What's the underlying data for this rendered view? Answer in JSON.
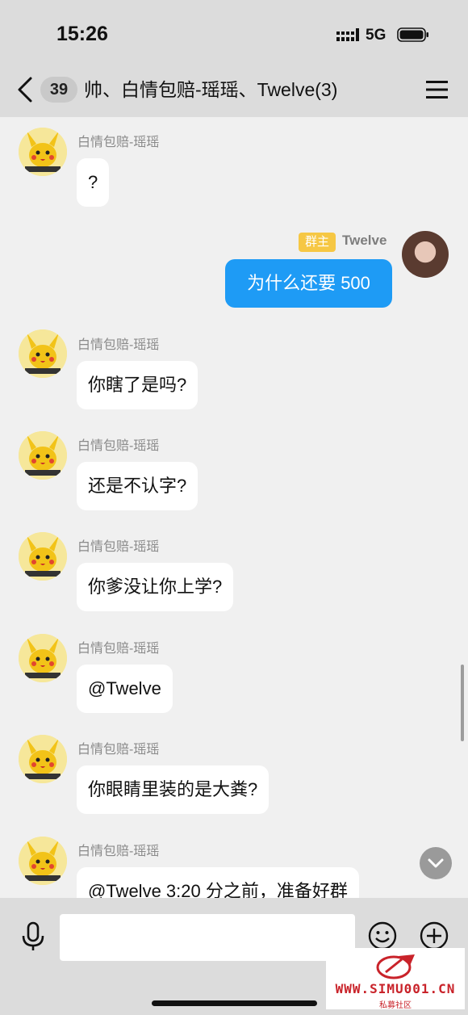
{
  "status_bar": {
    "time": "15:26",
    "network": "5G"
  },
  "header": {
    "unread_count": "39",
    "title": "帅、白情包赔-瑶瑶、Twelve(3)"
  },
  "messages": [
    {
      "sender": "白情包赔-瑶瑶",
      "text": "?"
    },
    {
      "sender": "Twelve",
      "role": "群主",
      "text": "为什么还要 500",
      "mine": true
    },
    {
      "sender": "白情包赔-瑶瑶",
      "text": "你瞎了是吗?"
    },
    {
      "sender": "白情包赔-瑶瑶",
      "text": "还是不认字?"
    },
    {
      "sender": "白情包赔-瑶瑶",
      "text": "你爹没让你上学?"
    },
    {
      "sender": "白情包赔-瑶瑶",
      "text": "@Twelve"
    },
    {
      "sender": "白情包赔-瑶瑶",
      "text": "你眼睛里装的是大粪?"
    },
    {
      "sender": "白情包赔-瑶瑶",
      "text": "@Twelve 3:20 分之前，准备好群"
    }
  ],
  "watermark": {
    "url": "WWW.SIMU001.CN",
    "sub": "私募社区"
  },
  "colors": {
    "header_bg": "#dcdcdc",
    "chat_bg": "#f0f0f0",
    "my_bubble": "#1e9bf5",
    "owner_tag": "#f6c744",
    "watermark": "#c9232a"
  },
  "icons": [
    "back-icon",
    "menu-icon",
    "signal-icon",
    "battery-icon",
    "chevron-down-icon",
    "microphone-icon",
    "emoji-icon",
    "plus-icon"
  ]
}
